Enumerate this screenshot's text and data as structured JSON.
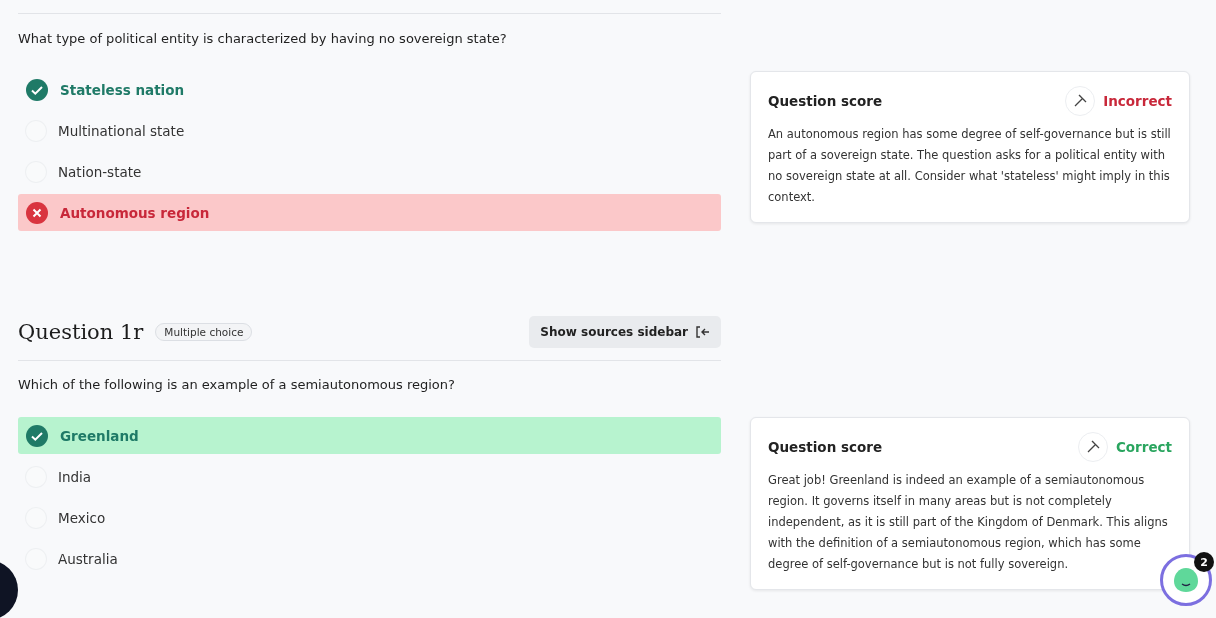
{
  "questions": [
    {
      "prompt": "What type of political entity is characterized by having no sovereign state?",
      "options": [
        {
          "label": "Stateless nation",
          "selected": false,
          "correct": true
        },
        {
          "label": "Multinational state",
          "selected": false,
          "correct": false
        },
        {
          "label": "Nation-state",
          "selected": false,
          "correct": false
        },
        {
          "label": "Autonomous region",
          "selected": true,
          "correct": false
        }
      ],
      "score": {
        "heading": "Question score",
        "verdict": "Incorrect",
        "correct": false,
        "feedback": "An autonomous region has some degree of self-governance but is still part of a sovereign state. The question asks for a political entity with no sovereign state at all. Consider what 'stateless' might imply in this context."
      }
    },
    {
      "title": "Question 1r",
      "type_badge": "Multiple choice",
      "sidebar_button": "Show sources sidebar",
      "prompt": "Which of the following is an example of a semiautonomous region?",
      "options": [
        {
          "label": "Greenland",
          "selected": true,
          "correct": true
        },
        {
          "label": "India",
          "selected": false,
          "correct": false
        },
        {
          "label": "Mexico",
          "selected": false,
          "correct": false
        },
        {
          "label": "Australia",
          "selected": false,
          "correct": false
        }
      ],
      "score": {
        "heading": "Question score",
        "verdict": "Correct",
        "correct": true,
        "feedback": "Great job! Greenland is indeed an example of a semiautonomous region. It governs itself in many areas but is not completely independent, as it is still part of the Kingdom of Denmark. This aligns with the definition of a semiautonomous region, which has some degree of self-governance but is not fully sovereign."
      }
    }
  ],
  "chat_badge": "2"
}
